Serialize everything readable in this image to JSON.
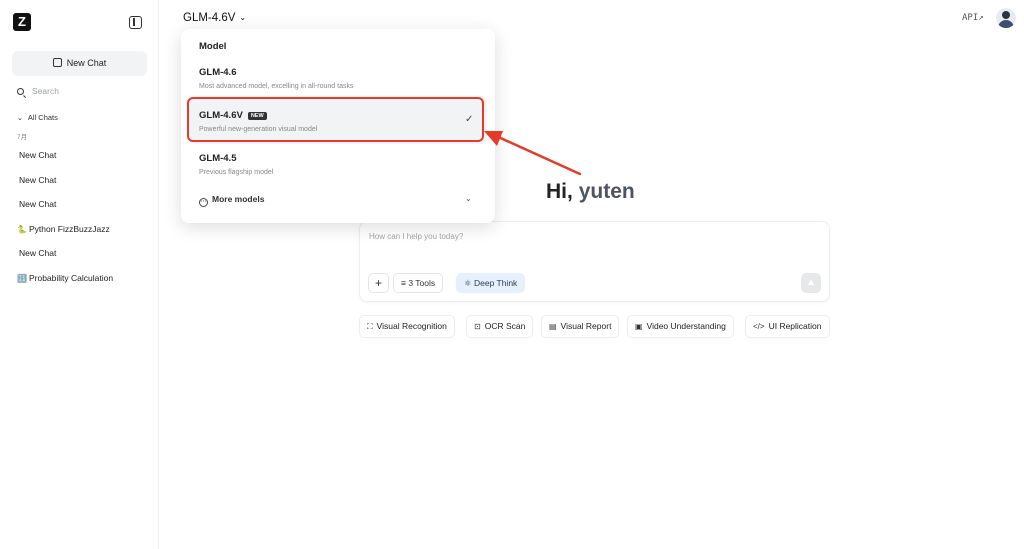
{
  "sidebar": {
    "logo": "Z",
    "new_chat_label": "New Chat",
    "search_placeholder": "Search",
    "all_chats_label": "All Chats",
    "month_label": "7月",
    "chats": [
      {
        "label": "New Chat",
        "emoji": ""
      },
      {
        "label": "New Chat",
        "emoji": ""
      },
      {
        "label": "New Chat",
        "emoji": ""
      },
      {
        "label": "Python FizzBuzzJazz",
        "emoji": "🐍"
      },
      {
        "label": "New Chat",
        "emoji": ""
      },
      {
        "label": "Probability Calculation",
        "emoji": "🔢"
      }
    ]
  },
  "header": {
    "model_selected": "GLM-4.6V",
    "api_label": "API",
    "api_arrow": "↗"
  },
  "dropdown": {
    "title": "Model",
    "options": [
      {
        "name": "GLM-4.6",
        "desc": "Most advanced model, excelling in all-round tasks"
      },
      {
        "name": "GLM-4.6V",
        "badge": "NEW",
        "desc": "Powerful new-generation visual model",
        "selected": true
      },
      {
        "name": "GLM-4.5",
        "desc": "Previous flagship model"
      }
    ],
    "more_label": "More models",
    "check_glyph": "✓",
    "chevron_glyph": "⌄"
  },
  "main": {
    "greeting_prefix": "Hi,",
    "greeting_name": "yuten",
    "input_placeholder": "How can I help you today?",
    "plus_label": "+",
    "tools_label": "3 Tools",
    "deep_think_label": "Deep Think",
    "quick_actions": [
      {
        "label": "Visual Recognition",
        "icon": "⛶"
      },
      {
        "label": "OCR Scan",
        "icon": "⊡"
      },
      {
        "label": "Visual Report",
        "icon": "▤"
      },
      {
        "label": "Video Understanding",
        "icon": "▣"
      },
      {
        "label": "UI Replication",
        "icon": "</>"
      }
    ]
  },
  "colors": {
    "annotation_red": "#e53b2b",
    "deep_think_bg": "#e6f0fd"
  }
}
